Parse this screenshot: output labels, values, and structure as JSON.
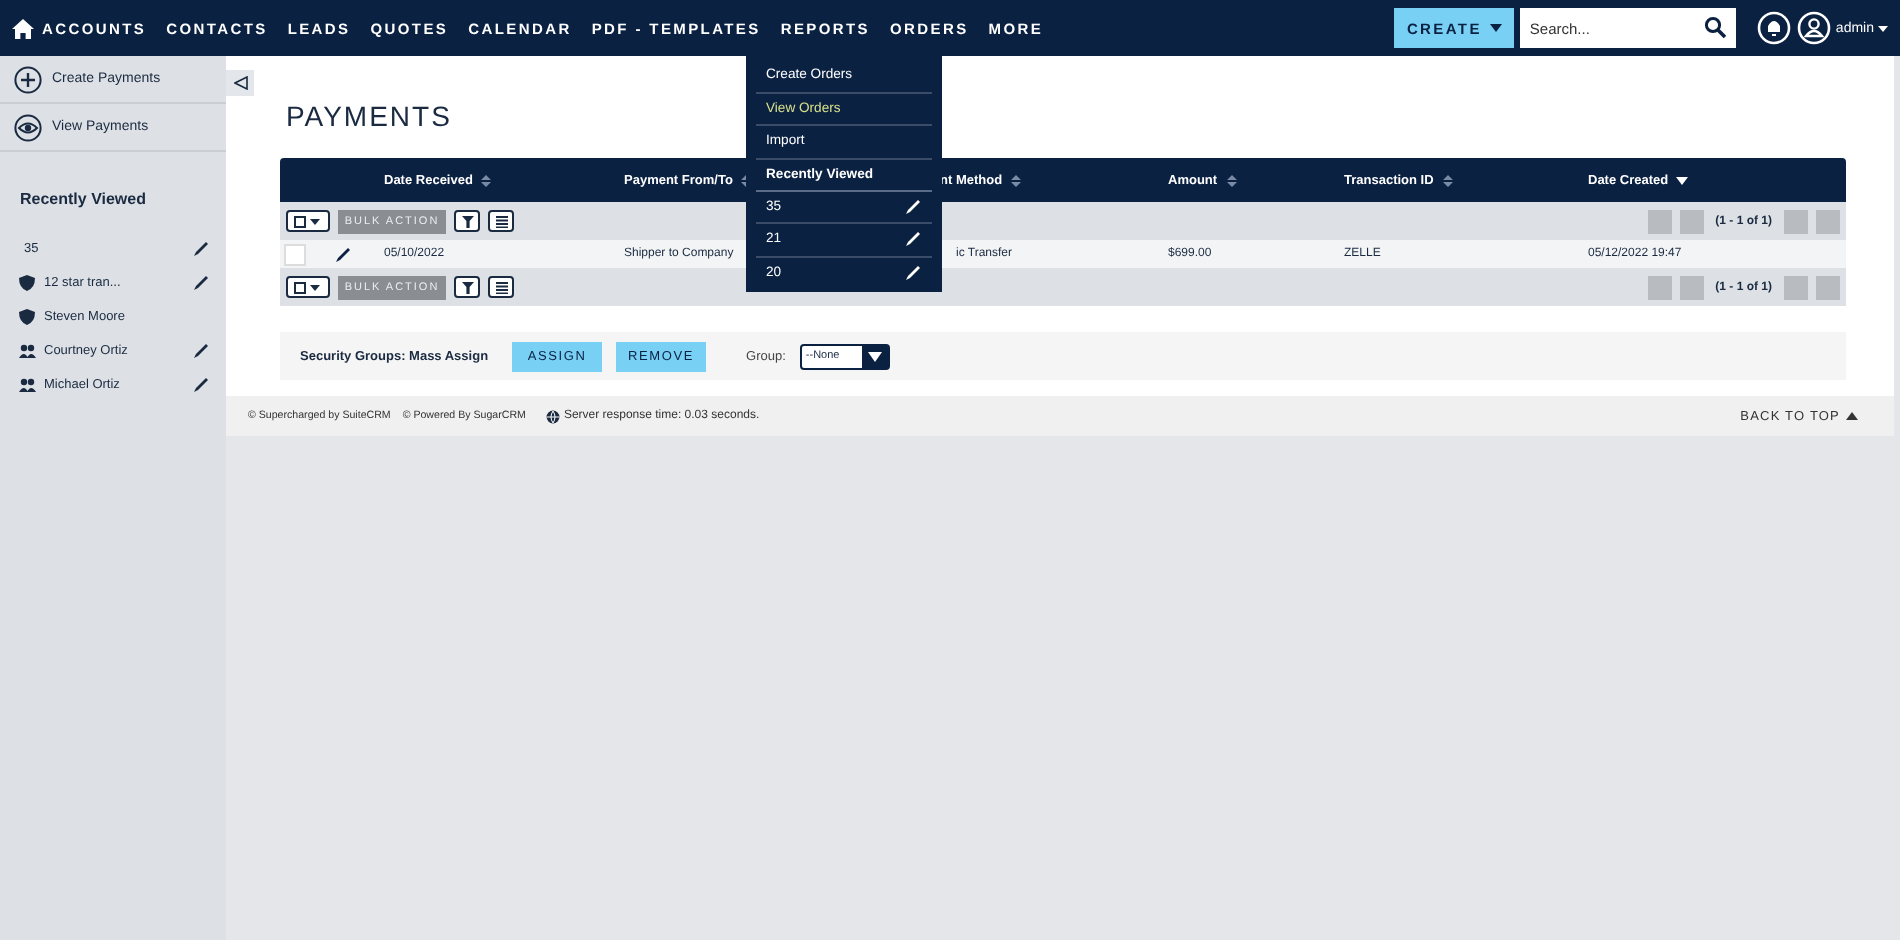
{
  "nav": {
    "items": [
      "ACCOUNTS",
      "CONTACTS",
      "LEADS",
      "QUOTES",
      "CALENDAR",
      "PDF - TEMPLATES",
      "REPORTS",
      "ORDERS",
      "MORE"
    ],
    "create_button": "CREATE",
    "search": {
      "placeholder": "Search..."
    },
    "user": "admin"
  },
  "orders_menu": {
    "items": [
      {
        "label": "Create Orders",
        "selected": false
      },
      {
        "label": "View Orders",
        "selected": true
      },
      {
        "label": "Import",
        "selected": false
      }
    ],
    "recent_heading": "Recently Viewed",
    "recent": [
      "35",
      "21",
      "20"
    ]
  },
  "sidebar": {
    "actions": [
      {
        "label": "Create Payments",
        "kind": "create"
      },
      {
        "label": "View Payments",
        "kind": "view"
      }
    ],
    "recent_heading": "Recently Viewed",
    "recent": [
      {
        "label": "35",
        "kind": "plain",
        "editable": true
      },
      {
        "label": "12 star tran...",
        "kind": "shield",
        "editable": true
      },
      {
        "label": "Steven Moore",
        "kind": "shield",
        "editable": false
      },
      {
        "label": "Courtney Ortiz",
        "kind": "people",
        "editable": true
      },
      {
        "label": "Michael Ortiz",
        "kind": "people",
        "editable": true
      }
    ]
  },
  "page_title": "PAYMENTS",
  "table": {
    "columns": [
      {
        "label": "Date Received",
        "sorted": false
      },
      {
        "label": "Payment From/To",
        "sorted": false
      },
      {
        "label": "nt Method",
        "sorted": false
      },
      {
        "label": "Amount",
        "sorted": false
      },
      {
        "label": "Transaction ID",
        "sorted": false
      },
      {
        "label": "Date Created",
        "sorted": true
      }
    ],
    "toolbars": [
      {
        "bulk_action": "BULK ACTION",
        "bulk_disabled": true,
        "pagination": "(1 - 1 of 1)"
      },
      {
        "bulk_action": "BULK ACTION",
        "bulk_disabled": true,
        "pagination": "(1 - 1 of 1)"
      }
    ],
    "rows": [
      {
        "checked": false,
        "cells": [
          "05/10/2022",
          "Shipper to Company",
          "ic Transfer",
          "$699.00",
          "ZELLE",
          "05/12/2022 19:47"
        ]
      }
    ]
  },
  "mass_assign": {
    "label": "Security Groups: Mass Assign",
    "buttons": [
      "ASSIGN",
      "REMOVE"
    ],
    "group_label": "Group:",
    "group_value": "--None"
  },
  "footer": {
    "credits": [
      "© Supercharged by SuiteCRM",
      "© Powered By SugarCRM"
    ],
    "response": "Server response time: 0.03 seconds.",
    "back_to_top": "BACK TO TOP"
  }
}
